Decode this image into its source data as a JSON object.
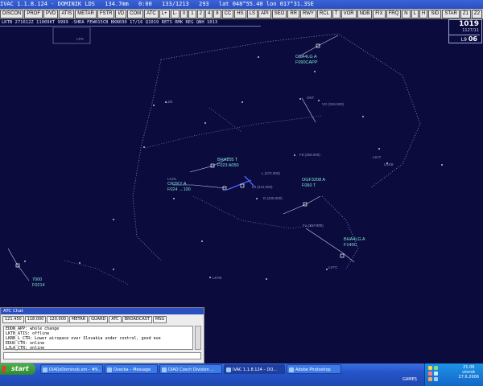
{
  "titlebar": {
    "title": "IVAC 1.1.8.124 - DOMINIK LDS",
    "freq": "134.7mm",
    "vis": "0:00",
    "sq": "133/1213",
    "alt": "293",
    "coords": "lat 048°55.40 lon 017°31.3SE"
  },
  "toolbar": {
    "buttons": [
      "DISCON",
      "PROF",
      "PVD",
      "ATIS",
      "METAR",
      "FSTR",
      "I/D",
      "COM",
      "ATC",
      "L+",
      "L-",
      "0",
      "1",
      "2",
      "4",
      "8",
      "CC",
      "HS",
      "LS",
      "API",
      "SEO",
      "RR",
      "RWY",
      "RCL",
      "T",
      "VOR",
      "NDB",
      "FIX",
      "FRQ",
      "N",
      "L",
      "H",
      "SID",
      "STAR",
      "Z1",
      "Z2",
      "Z3",
      "Z4"
    ]
  },
  "metar": {
    "text": "LKTB 271612Z 11009KT 9999 -SHRA FEW015CB BKN030 17/16 Q1019 RETS RMK REG QNH 1013"
  },
  "clock": {
    "qnh": "1019",
    "date": "1127/11",
    "level_label": "L9",
    "level_value": "06"
  },
  "radar": {
    "colors": {
      "background": "#0b0b3e",
      "boundary": "#8e98c6",
      "label": "#7fe6d2",
      "fix": "#8a97c9",
      "tag_line": "#c8d0f0",
      "selected": "#4b63ff"
    },
    "range_label": "LPG",
    "aircraft": [
      {
        "callsign": "CSA4LG A",
        "line2": "F090CAPP"
      },
      {
        "callsign": "BHA105 T",
        "line2": "F023 A050"
      },
      {
        "callsign": "CRZKY A",
        "line2": "F024 →100"
      },
      {
        "callsign": "OGF3208 A",
        "line2": "F060 T"
      },
      {
        "callsign": "BHA4LG A",
        "line2": "F140C"
      },
      {
        "callsign": "7000",
        "line2": "F0214"
      }
    ],
    "fixes": [
      "L2N",
      "VO (315.000)",
      "F8 (356.000)",
      "L (272.000)",
      "L3 (312.000)",
      "D (428.000)",
      "Fo (357.000)",
      "LKLT",
      "LKKB",
      "LKOL",
      "LKTB",
      "LKTC",
      "OKT"
    ]
  },
  "chat": {
    "title": "ATC Chat",
    "tabs": [
      "121.450",
      "118.000",
      "120.000",
      "METAR",
      "GUARD",
      "ATC",
      "BROADCAST",
      "MSG"
    ],
    "messages": [
      "EDDN_APP: whole change",
      "LKTB_ATIS: offline",
      "LKBB_L_CTR: Lower airspace over Slovakia under control, good eve",
      "EDUU_CTR: online",
      "LJLA_CTR: online"
    ]
  },
  "taskbar": {
    "start_label": "start",
    "tasks": [
      {
        "label": "DIAQsDominob.vm – #9...",
        "active": false
      },
      {
        "label": "Ovecka – Message",
        "active": false
      },
      {
        "label": "DIAO Czech Division ...",
        "active": false
      },
      {
        "label": "IVAC 1.1.8.124 – DO...",
        "active": true
      },
      {
        "label": "Adobe Photoshop",
        "active": false
      }
    ],
    "quick_label": "GAMES",
    "clock_time": "21:06",
    "clock_day": "utorok",
    "clock_date": "27.6.2006"
  }
}
